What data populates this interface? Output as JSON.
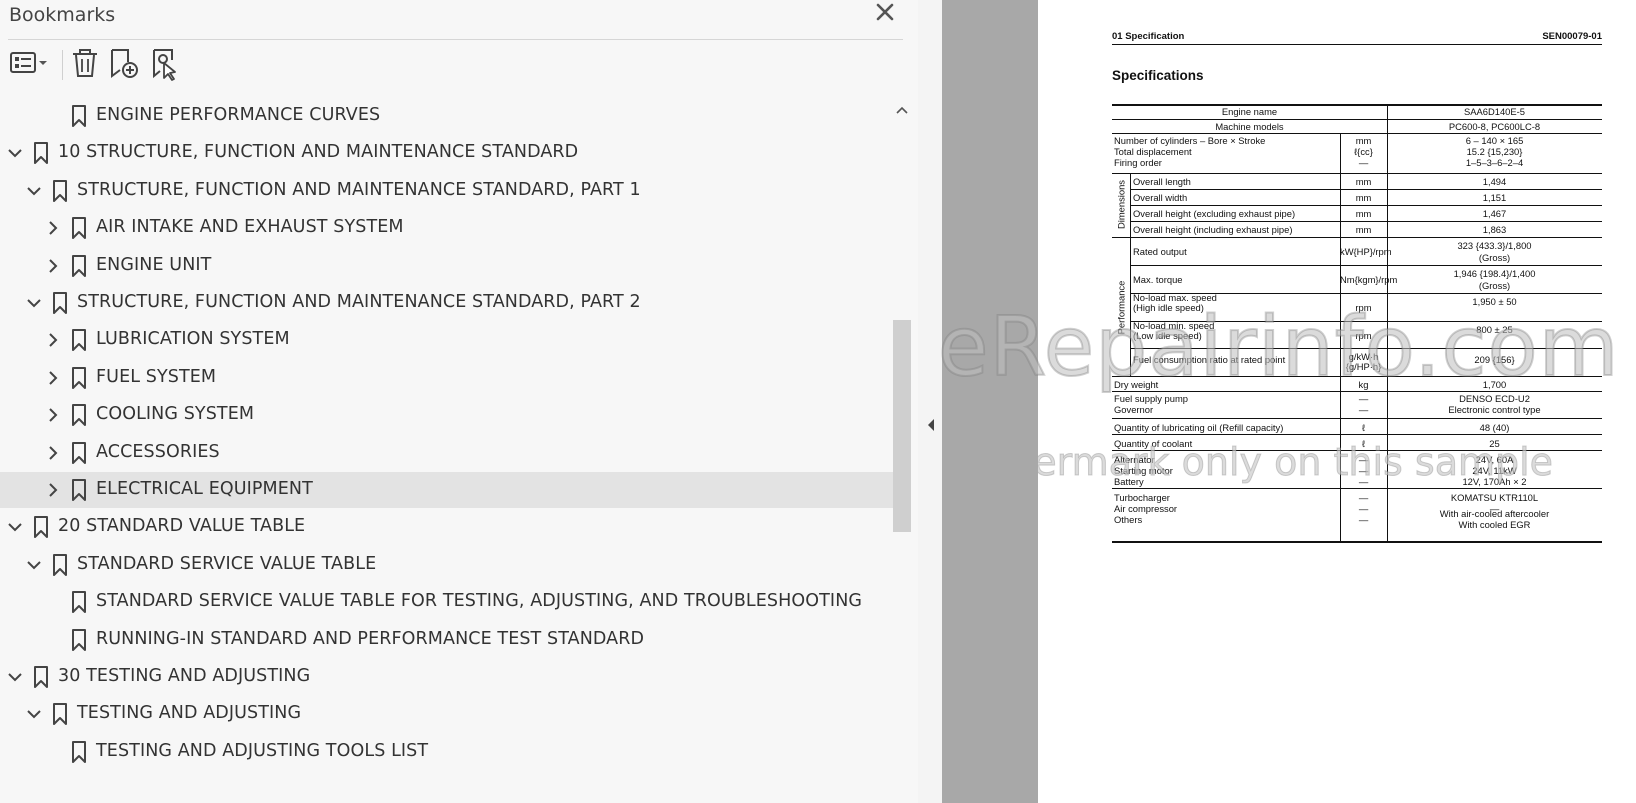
{
  "panel": {
    "title": "Bookmarks",
    "close_icon": "close-icon",
    "toolbar": [
      "options-menu-icon",
      "delete-icon",
      "add-bookmark-icon",
      "find-bookmark-icon"
    ]
  },
  "tree": [
    {
      "label": "ENGINE PERFORMANCE CURVES",
      "level": 2,
      "chevron": "none"
    },
    {
      "label": "10 STRUCTURE, FUNCTION AND MAINTENANCE STANDARD",
      "level": 0,
      "chevron": "down"
    },
    {
      "label": "STRUCTURE, FUNCTION AND MAINTENANCE STANDARD, PART 1",
      "level": 1,
      "chevron": "down"
    },
    {
      "label": "AIR INTAKE AND EXHAUST SYSTEM",
      "level": 2,
      "chevron": "right"
    },
    {
      "label": "ENGINE UNIT",
      "level": 2,
      "chevron": "right"
    },
    {
      "label": "STRUCTURE, FUNCTION AND MAINTENANCE STANDARD, PART 2",
      "level": 1,
      "chevron": "down"
    },
    {
      "label": "LUBRICATION SYSTEM",
      "level": 2,
      "chevron": "right"
    },
    {
      "label": "FUEL SYSTEM",
      "level": 2,
      "chevron": "right"
    },
    {
      "label": "COOLING SYSTEM",
      "level": 2,
      "chevron": "right"
    },
    {
      "label": "ACCESSORIES",
      "level": 2,
      "chevron": "right"
    },
    {
      "label": "ELECTRICAL EQUIPMENT",
      "level": 2,
      "chevron": "right",
      "selected": true
    },
    {
      "label": "20 STANDARD VALUE TABLE",
      "level": 0,
      "chevron": "down"
    },
    {
      "label": "STANDARD SERVICE VALUE TABLE",
      "level": 1,
      "chevron": "down"
    },
    {
      "label": "STANDARD SERVICE VALUE TABLE FOR TESTING, ADJUSTING, AND TROUBLESHOOTING",
      "level": 2,
      "chevron": "none"
    },
    {
      "label": "RUNNING-IN STANDARD AND PERFORMANCE TEST STANDARD",
      "level": 2,
      "chevron": "none"
    },
    {
      "label": "30 TESTING AND ADJUSTING",
      "level": 0,
      "chevron": "down"
    },
    {
      "label": "TESTING AND ADJUSTING",
      "level": 1,
      "chevron": "down"
    },
    {
      "label": "TESTING AND ADJUSTING TOOLS LIST",
      "level": 2,
      "chevron": "none"
    }
  ],
  "doc": {
    "header_left": "01 Specification",
    "header_right": "SEN00079-01",
    "title": "Specifications",
    "engine_name_label": "Engine name",
    "engine_name": "SAA6D140E-5",
    "machine_models_label": "Machine models",
    "machine_models": "PC600-8, PC600LC-8",
    "group_dimensions": "Dimensions",
    "group_performance": "Performance",
    "rows": [
      {
        "item": "Number of cylinders – Bore × Stroke",
        "unit": "mm",
        "value": "6 – 140 × 165"
      },
      {
        "item": "Total displacement",
        "unit": "ℓ{cc}",
        "value": "15.2 {15,230}"
      },
      {
        "item": "Firing order",
        "unit": "—",
        "value": "1–5–3–6–2–4"
      },
      {
        "item": "Overall length",
        "unit": "mm",
        "value": "1,494"
      },
      {
        "item": "Overall width",
        "unit": "mm",
        "value": "1,151"
      },
      {
        "item": "Overall height (excluding exhaust pipe)",
        "unit": "mm",
        "value": "1,467"
      },
      {
        "item": "Overall height (including exhaust pipe)",
        "unit": "mm",
        "value": "1,863"
      },
      {
        "item": "Rated output",
        "unit": "kW{HP}/rpm",
        "value": "323 {433.3}/1,800",
        "value2": "(Gross)"
      },
      {
        "item": "Max. torque",
        "unit": "Nm{kgm}/rpm",
        "value": "1,946 {198.4}/1,400",
        "value2": "(Gross)"
      },
      {
        "item": "No-load max. speed",
        "item2": "(High idle speed)",
        "unit": "rpm",
        "value": "1,950 ± 50"
      },
      {
        "item": "No-load min. speed",
        "item2": "(Low idle speed)",
        "unit": "rpm",
        "value": "800 ± 25"
      },
      {
        "item": "Fuel consumption ratio at rated point",
        "unit": "g/kW·h",
        "unit2": "{g/HP·h}",
        "value": "209 {156}"
      },
      {
        "item": "Dry weight",
        "unit": "kg",
        "value": "1,700"
      },
      {
        "item": "Fuel supply pump",
        "unit": "—",
        "value": "DENSO ECD-U2"
      },
      {
        "item": "Governor",
        "unit": "—",
        "value": "Electronic control type"
      },
      {
        "item": "Quantity of lubricating oil (Refill capacity)",
        "unit": "ℓ",
        "value": "48 (40)"
      },
      {
        "item": "Quantity of coolant",
        "unit": "ℓ",
        "value": "25"
      },
      {
        "item": "Alternator",
        "unit": "—",
        "value": "24V, 60A"
      },
      {
        "item": "Starting motor",
        "unit": "—",
        "value": "24V, 11kW"
      },
      {
        "item": "Battery",
        "unit": "—",
        "value": "12V, 170Ah × 2"
      },
      {
        "item": "Turbocharger",
        "unit": "—",
        "value": "KOMATSU KTR110L"
      },
      {
        "item": "Air compressor",
        "unit": "—",
        "value": "—"
      },
      {
        "item": "Others",
        "unit": "—",
        "value": "With air-cooled aftercooler",
        "value2": "With cooled EGR"
      }
    ],
    "watermark_main": "eRepairinfo.com",
    "watermark_sub": "watermark only on this sample"
  }
}
